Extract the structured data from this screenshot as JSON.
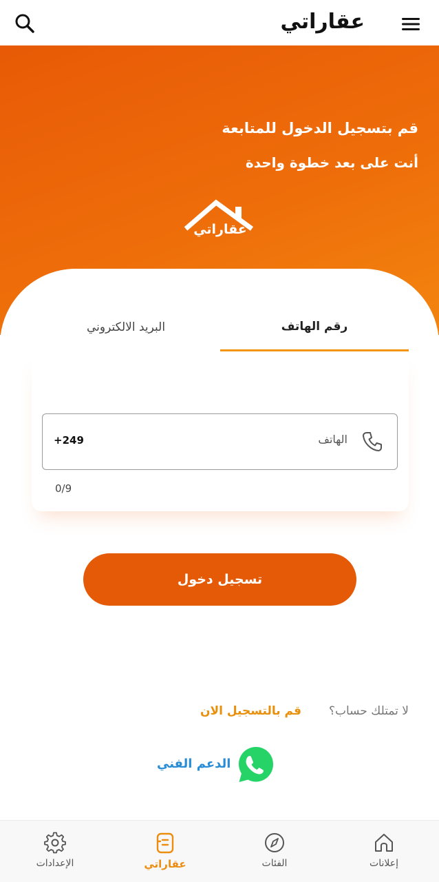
{
  "header": {
    "title": "عقاراتي",
    "search_icon": "search-icon",
    "menu_icon": "menu-icon"
  },
  "hero": {
    "line1": "قم بتسجيل الدخول للمتابعة",
    "line2": "أنت على بعد خطوة واحدة",
    "logo_text": "عقاراتي"
  },
  "tabs": [
    {
      "label": "رقم الهاتف",
      "active": true
    },
    {
      "label": "البريد الالكتروني",
      "active": false
    }
  ],
  "phone_field": {
    "prefix": "+249",
    "label": "الهاتف",
    "icon": "phone-icon",
    "counter": "0/9"
  },
  "login_button": "تسجيل دخول",
  "signup": {
    "question": "لا تمتلك حساب؟",
    "link": "قم بالتسجيل الان"
  },
  "support": {
    "label": "الدعم الفني",
    "icon": "whatsapp-icon"
  },
  "bottom_nav": [
    {
      "label": "الإعدادات",
      "icon": "gear-icon",
      "active": false
    },
    {
      "label": "عقاراتي",
      "icon": "document-icon",
      "active": true
    },
    {
      "label": "الفئات",
      "icon": "compass-icon",
      "active": false
    },
    {
      "label": "إعلانات",
      "icon": "home-icon",
      "active": false
    }
  ],
  "colors": {
    "primary_orange": "#e55a06",
    "accent": "#f39312",
    "link_blue": "#2a8cd4",
    "whatsapp_green": "#25d366"
  }
}
